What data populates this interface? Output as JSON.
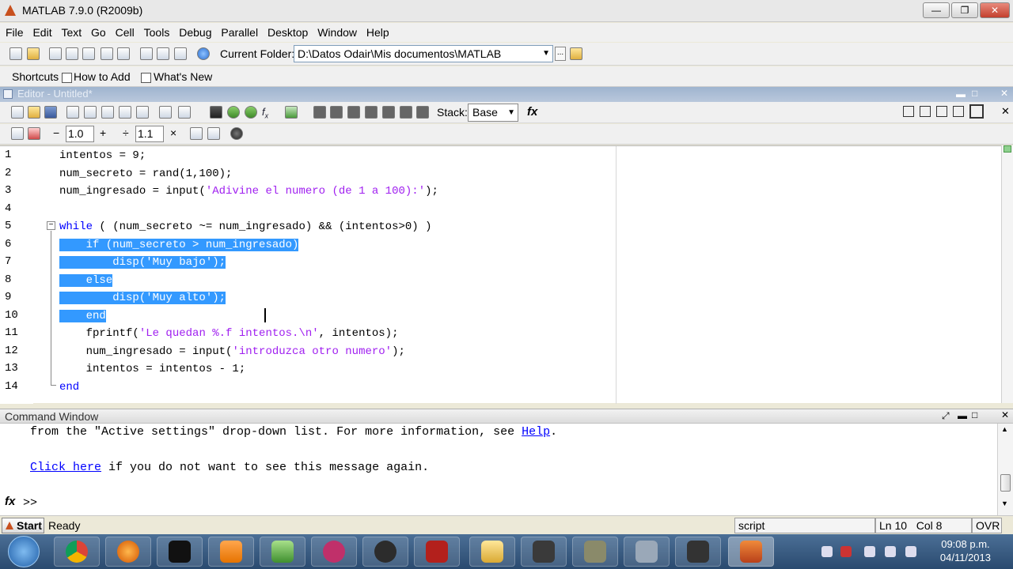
{
  "window": {
    "title": "MATLAB  7.9.0 (R2009b)"
  },
  "menu": [
    "File",
    "Edit",
    "Text",
    "Go",
    "Cell",
    "Tools",
    "Debug",
    "Parallel",
    "Desktop",
    "Window",
    "Help"
  ],
  "toolbar": {
    "current_folder_label": "Current Folder:",
    "current_folder_value": "D:\\Datos Odair\\Mis documentos\\MATLAB",
    "browse_label": "..."
  },
  "shortcuts": {
    "shortcuts_label": "Shortcuts",
    "how_to_add": "How to Add",
    "whats_new": "What's New"
  },
  "editor": {
    "title": "Editor - Untitled*",
    "stack_label": "Stack:",
    "stack_value": "Base",
    "fx_label": "fx",
    "cell_tb": {
      "minus": "−",
      "value1": "1.0",
      "plus": "+",
      "divide": "÷",
      "value2": "1.1",
      "times": "×"
    },
    "lines": [
      {
        "n": "1",
        "segs": [
          {
            "t": "intentos = 9;"
          }
        ]
      },
      {
        "n": "2",
        "segs": [
          {
            "t": "num_secreto = rand(1,100);"
          }
        ]
      },
      {
        "n": "3",
        "segs": [
          {
            "t": "num_ingresado = input("
          },
          {
            "t": "'Adivine el numero (de 1 a 100):'",
            "c": "str"
          },
          {
            "t": ");"
          }
        ]
      },
      {
        "n": "4",
        "segs": []
      },
      {
        "n": "5",
        "segs": [
          {
            "t": "while",
            "c": "kw"
          },
          {
            "t": " ( (num_secreto ~= num_ingresado) && (intentos>0) )"
          }
        ]
      },
      {
        "n": "6",
        "segs": [
          {
            "t": "    if (num_secreto > num_ingresado)",
            "c": "sel"
          }
        ]
      },
      {
        "n": "7",
        "segs": [
          {
            "t": "        disp('Muy bajo');",
            "c": "sel"
          }
        ]
      },
      {
        "n": "8",
        "segs": [
          {
            "t": "    else",
            "c": "sel"
          }
        ]
      },
      {
        "n": "9",
        "segs": [
          {
            "t": "        disp('Muy alto');",
            "c": "sel"
          }
        ]
      },
      {
        "n": "10",
        "segs": [
          {
            "t": "    end",
            "c": "sel"
          }
        ]
      },
      {
        "n": "11",
        "segs": [
          {
            "t": "    fprintf("
          },
          {
            "t": "'Le quedan %.f intentos.\\n'",
            "c": "str"
          },
          {
            "t": ", intentos);"
          }
        ]
      },
      {
        "n": "12",
        "segs": [
          {
            "t": "    num_ingresado = input("
          },
          {
            "t": "'introduzca otro numero'",
            "c": "str"
          },
          {
            "t": ");"
          }
        ]
      },
      {
        "n": "13",
        "segs": [
          {
            "t": "    intentos = intentos - 1;"
          }
        ]
      },
      {
        "n": "14",
        "segs": [
          {
            "t": "end",
            "c": "kw"
          }
        ]
      }
    ]
  },
  "command_window": {
    "title": "Command Window",
    "line1_pre": "from the \"Active settings\" drop-down list. For more information, see ",
    "line1_link": "Help",
    "line1_post": ".",
    "line2_link": "Click here",
    "line2_post": " if you do not want to see this message again.",
    "prompt_fx": "fx",
    "prompt": ">>"
  },
  "status": {
    "start": "Start",
    "ready": "Ready",
    "mode": "script",
    "ln_label": "Ln",
    "ln": "10",
    "col_label": "Col",
    "col": "8",
    "ovr": "OVR"
  },
  "taskbar": {
    "time": "09:08 p.m.",
    "date": "04/11/2013"
  },
  "colors": {
    "keyword": "#0000ff",
    "string": "#a020f0",
    "selection": "#3399ff",
    "link": "#0000ff"
  }
}
